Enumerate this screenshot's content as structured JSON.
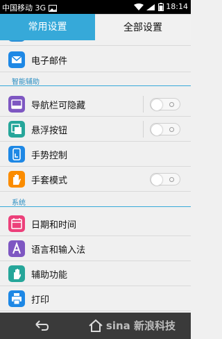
{
  "status_bar": {
    "carrier": "中国移动 3G",
    "time": "18:14"
  },
  "tabs": {
    "common": "常用设置",
    "all": "全部设置"
  },
  "rows": {
    "email": "电子邮件",
    "nav_bar": "导航栏可隐藏",
    "floating_button": "悬浮按钮",
    "gesture": "手势控制",
    "glove": "手套模式",
    "datetime": "日期和时间",
    "language": "语言和输入法",
    "accessibility": "辅助功能",
    "print": "打印"
  },
  "sections": {
    "smart": "智能辅助",
    "system": "系统"
  },
  "toggles": {
    "nav_bar": false,
    "floating_button": false,
    "glove": false
  },
  "watermark": "sina 新浪科技",
  "colors": {
    "accent": "#36a9d9",
    "status_bar": "#000000",
    "nav_bar": "#3a3a3a"
  },
  "icons": {
    "email": "email-icon",
    "nav_bar": "nav-bar-icon",
    "floating_button": "floating-button-icon",
    "gesture": "gesture-icon",
    "glove": "glove-icon",
    "datetime": "calendar-icon",
    "language": "language-icon",
    "accessibility": "accessibility-icon",
    "print": "printer-icon"
  }
}
